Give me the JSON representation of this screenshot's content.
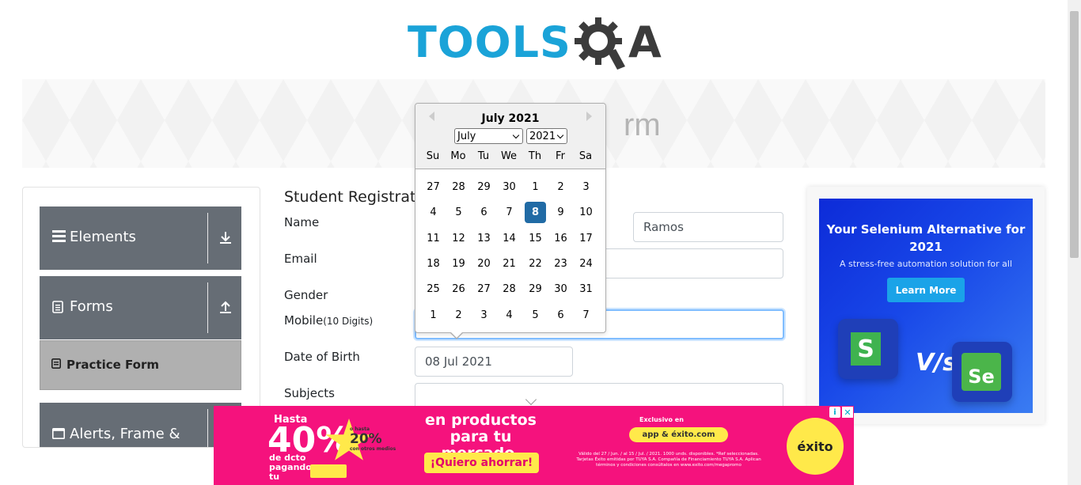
{
  "logo": {
    "tools": "TOOLS",
    "qa_a": "A"
  },
  "banner": {
    "title_fragment": "rm"
  },
  "menu": {
    "groups": [
      {
        "label": "Elements",
        "icon": "hamburger-icon",
        "arrow": "download-arrow-icon"
      },
      {
        "label": "Forms",
        "icon": "document-icon",
        "arrow": "upload-arrow-icon"
      },
      {
        "label": "Alerts, Frame &",
        "icon": "window-icon"
      }
    ],
    "active_item": "Practice Form"
  },
  "form": {
    "title": "Student Registratio",
    "labels": {
      "name": "Name",
      "email": "Email",
      "gender": "Gender",
      "mobile": "Mobile",
      "mobile_hint": "(10 Digits)",
      "dob": "Date of Birth",
      "subjects": "Subjects"
    },
    "last_name_value": "Ramos",
    "mobile_value": "",
    "dob_value": "08 Jul 2021",
    "subjects_value": ""
  },
  "datepicker": {
    "title": "July 2021",
    "month_select": "July",
    "year_select": "2021",
    "weekdays": [
      "Su",
      "Mo",
      "Tu",
      "We",
      "Th",
      "Fr",
      "Sa"
    ],
    "weeks": [
      [
        "27",
        "28",
        "29",
        "30",
        "1",
        "2",
        "3"
      ],
      [
        "4",
        "5",
        "6",
        "7",
        "8",
        "9",
        "10"
      ],
      [
        "11",
        "12",
        "13",
        "14",
        "15",
        "16",
        "17"
      ],
      [
        "18",
        "19",
        "20",
        "21",
        "22",
        "23",
        "24"
      ],
      [
        "25",
        "26",
        "27",
        "28",
        "29",
        "30",
        "31"
      ],
      [
        "1",
        "2",
        "3",
        "4",
        "5",
        "6",
        "7"
      ]
    ],
    "selected_day": "8"
  },
  "ad_right": {
    "headline": "Your Selenium Alternative for 2021",
    "subline": "A stress-free automation solution for all",
    "button": "Learn More",
    "vs": "V/s",
    "left_logo": "S",
    "right_logo": "Se"
  },
  "ad_bottom": {
    "hasta": "Hasta",
    "percent": "40%",
    "star_prefix": "o hasta",
    "star_percent": "20%",
    "star_suffix": "con otros medios",
    "dcto": "de dcto pagando con tu",
    "main": "en productos para tu mercado.",
    "cta": "¡Quiero ahorrar!",
    "exclusivo": "Exclusivo en",
    "app": "app & éxito.com",
    "fine": "Válido del 27 / Jun. / al 15 / Jul. / 2021. 1000 unds. disponibles. *Ref seleccionadas. Tarjetas Éxito emitidas por TUYA S.A. Compañía de Financiamiento TUYA S.A. Aplican términos y condiciones consúltalos en www.exito.com/megapromo",
    "brand": "éxito",
    "info": "i",
    "close": "✕"
  },
  "colors": {
    "brand_blue": "#1aa3d8",
    "menu_gray": "#666d75",
    "selected_day": "#216ba5",
    "ad_pink": "#f5127d",
    "ad_yellow": "#ffe94a"
  }
}
